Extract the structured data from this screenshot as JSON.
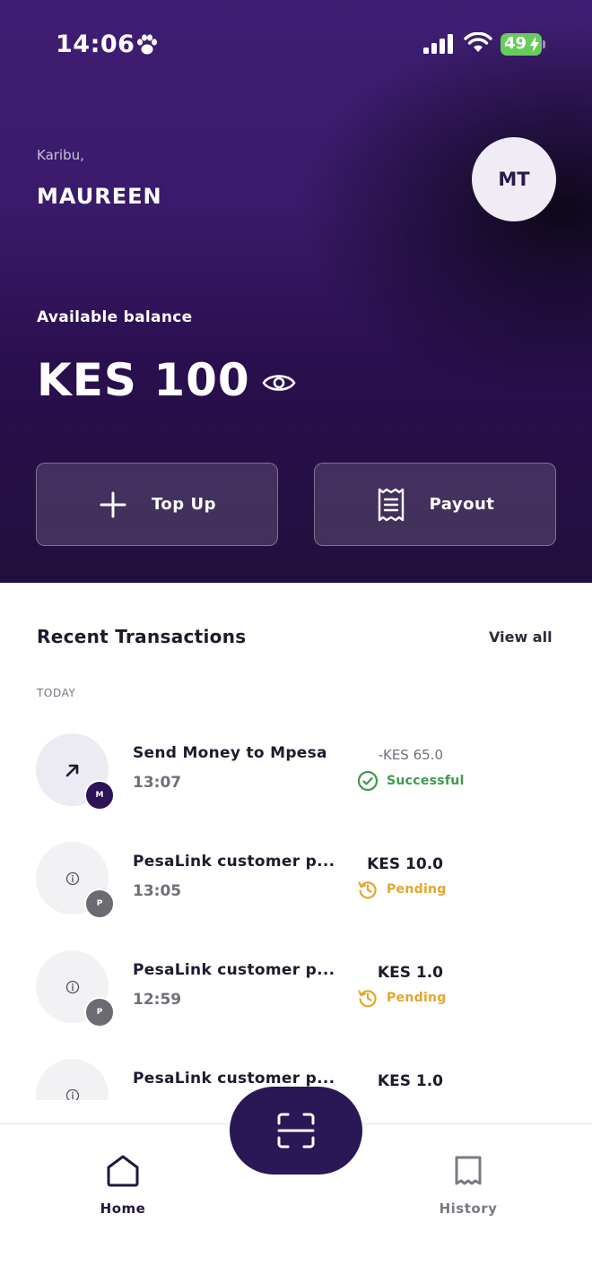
{
  "status_bar": {
    "time": "14:06",
    "battery": "49"
  },
  "header": {
    "greeting": "Karibu,",
    "user_name": "MAUREEN",
    "avatar_initials": "MT",
    "balance_label": "Available balance",
    "balance_amount": "KES 100"
  },
  "actions": {
    "top_up_label": "Top Up",
    "payout_label": "Payout"
  },
  "transactions": {
    "title": "Recent Transactions",
    "view_all": "View all",
    "group_label": "TODAY",
    "items": [
      {
        "title": "Send Money to Mpesa",
        "time": "13:07",
        "amount": "-KES 65.0",
        "status": "Successful",
        "badge": "M",
        "icon": "arrow-up-right-icon"
      },
      {
        "title": "PesaLink customer p...",
        "time": "13:05",
        "amount": "KES 10.0",
        "status": "Pending",
        "badge": "P",
        "icon": "info-icon"
      },
      {
        "title": "PesaLink customer p...",
        "time": "12:59",
        "amount": "KES 1.0",
        "status": "Pending",
        "badge": "P",
        "icon": "info-icon"
      },
      {
        "title": "PesaLink customer p...",
        "time": "",
        "amount": "KES 1.0",
        "status": "",
        "badge": "",
        "icon": "info-icon"
      }
    ]
  },
  "nav": {
    "home_label": "Home",
    "history_label": "History"
  },
  "colors": {
    "primary": "#2a1756",
    "success": "#3f9a4b",
    "pending": "#e6a62a",
    "hero_top": "#3f1e73"
  }
}
